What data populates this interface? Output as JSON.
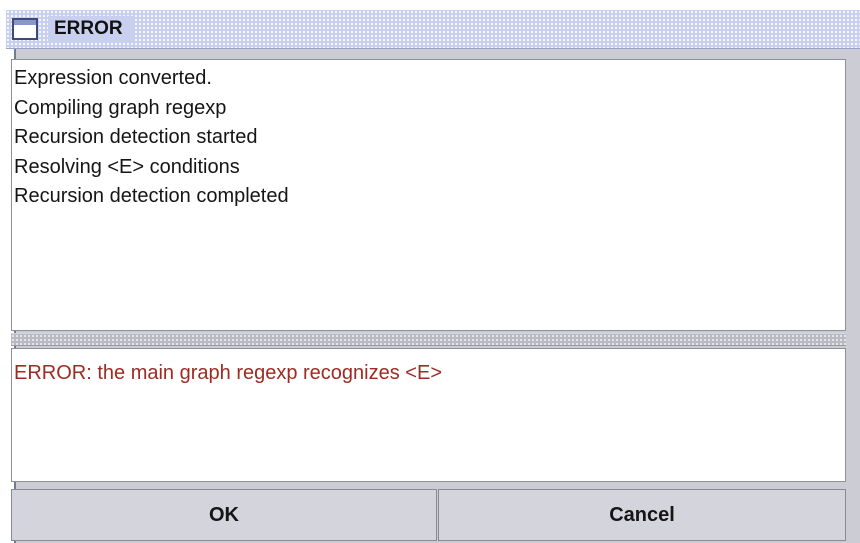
{
  "dialog": {
    "title": "ERROR",
    "title_icon": "window-icon",
    "log_lines": [
      "Expression converted.",
      "Compiling graph regexp",
      "Recursion detection started",
      "Resolving <E> conditions",
      "Recursion detection completed"
    ],
    "error_message": "ERROR: the main graph regexp recognizes <E>",
    "buttons": {
      "ok_label": "OK",
      "cancel_label": "Cancel"
    }
  },
  "colors": {
    "error_text": "#9e2a22",
    "title_bar": "#c9cfee",
    "button_face": "#d4d4dc"
  }
}
